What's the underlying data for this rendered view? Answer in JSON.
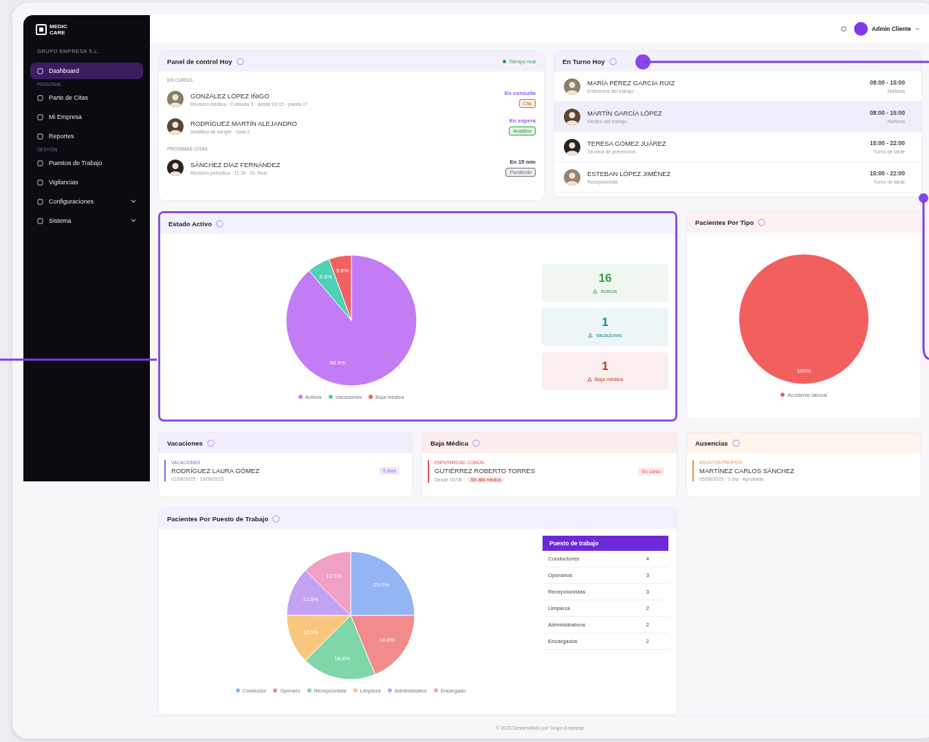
{
  "sidebar": {
    "logo": "MEDIC CARE",
    "company": "GRUPO EMPRESA S.L.",
    "sections": [
      {
        "items": [
          {
            "label": "Dashboard",
            "kind": "link",
            "selected": true
          }
        ]
      },
      {
        "heading": "PERSONAL",
        "items": [
          {
            "label": "Parte de Citas",
            "kind": "link",
            "selected": false
          },
          {
            "label": "Mi Empresa",
            "kind": "link",
            "selected": false
          },
          {
            "label": "Reportes",
            "kind": "link",
            "selected": false
          }
        ]
      },
      {
        "heading": "GESTIÓN",
        "items": [
          {
            "label": "Puestos de Trabajo",
            "kind": "link",
            "selected": false
          },
          {
            "label": "Vigilancias",
            "kind": "link",
            "selected": false
          },
          {
            "label": "Configuraciones",
            "kind": "menu",
            "selected": false
          },
          {
            "label": "Sistema",
            "kind": "menu",
            "selected": false
          }
        ]
      }
    ]
  },
  "header": {
    "user_name": "Admin Cliente"
  },
  "today_panel": {
    "title": "Panel de control Hoy",
    "status": "Tiempo real",
    "groups": [
      {
        "heading": "EN CURSO",
        "rows": [
          {
            "name": "GONZÁLEZ LÓPEZ ÍÑIGO",
            "detail": "Revisión médica · Consulta 3 · desde 09:15 · planta 1ª",
            "state": "En consulta",
            "kind": "current",
            "badge": {
              "text": "Cita",
              "color": "#b7791f"
            }
          },
          {
            "name": "RODRÍGUEZ MARTÍN ALEJANDRO",
            "detail": "Analítica de sangre · Sala 2",
            "state": "En espera",
            "kind": "current",
            "badge": {
              "text": "Analítica",
              "color": "#2f9e44"
            }
          }
        ]
      },
      {
        "heading": "PRÓXIMAS CITAS",
        "rows": [
          {
            "name": "SÁNCHEZ DÍAZ FERNÁNDEZ",
            "detail": "Revisión periódica · 11:30 · Dr. Ruiz",
            "state": "En 15 min",
            "kind": "upcoming",
            "badge": {
              "text": "Pendiente",
              "color": "#6b7280"
            }
          }
        ]
      }
    ]
  },
  "shift_panel": {
    "title": "En Turno Hoy",
    "rows": [
      {
        "name": "MARÍA PÉREZ GARCÍA RUIZ",
        "role": "Enfermera del trabajo",
        "time": "08:00 - 15:00",
        "shift": "Mañana",
        "selected": false
      },
      {
        "name": "MARTÍN GARCÍA LÓPEZ",
        "role": "Médico del trabajo",
        "time": "08:00 - 15:00",
        "shift": "Mañana",
        "selected": true
      },
      {
        "name": "TERESA GÓMEZ JUÁREZ",
        "role": "Técnica de prevención",
        "time": "15:00 - 22:00",
        "shift": "Turno de tarde",
        "selected": false
      },
      {
        "name": "ESTEBAN LÓPEZ JIMÉNEZ",
        "role": "Recepcionista",
        "time": "15:00 - 22:00",
        "shift": "Turno de tarde",
        "selected": false
      }
    ]
  },
  "status_card": {
    "title": "Estado Activo",
    "highlighted": true,
    "chart_data": {
      "type": "pie",
      "categories": [
        "Activos",
        "Vacaciones",
        "Baja médica"
      ],
      "colors": [
        "#c27cf5",
        "#4fd1b5",
        "#f06262"
      ],
      "series": [
        {
          "values": [
            88.9,
            5.6,
            5.6
          ]
        }
      ],
      "legend": "bottom",
      "value_labels": [
        "88.9%",
        "5.6%",
        "5.6%"
      ]
    },
    "stats": [
      {
        "value": "16",
        "label": "Activos",
        "color": "#2f9e44"
      },
      {
        "value": "1",
        "label": "Vacaciones",
        "color": "#0f8b8d"
      },
      {
        "value": "1",
        "label": "Baja médica",
        "color": "#c0392b"
      }
    ]
  },
  "type_card": {
    "title": "Pacientes Por Tipo",
    "chart_data": {
      "type": "pie",
      "categories": [
        "Accidente laboral"
      ],
      "colors": [
        "#f25f5f"
      ],
      "series": [
        {
          "values": [
            100
          ]
        }
      ],
      "legend": "bottom",
      "value_labels": [
        "100%"
      ]
    }
  },
  "absence_cards": [
    {
      "title": "Vacaciones",
      "color": "#8b5cf6",
      "tag": "VACACIONES",
      "name": "RODRÍGUEZ LAURA GÓMEZ",
      "detail": "01/08/2025 · 15/08/2025",
      "badge": "5 días"
    },
    {
      "title": "Baja Médica",
      "color": "#e05252",
      "tag": "ENFERMEDAD COMÚN",
      "name": "GUTIÉRREZ ROBERTO TORRES",
      "detail": "Desde 02/08 ·",
      "note": "Sin alta médica",
      "badge": "En curso"
    },
    {
      "title": "Ausencias",
      "color": "#e8963a",
      "tag": "ASUNTOS PROPIOS",
      "name": "MARTÍNEZ CARLOS SÁNCHEZ",
      "detail": "05/08/2025 · 1 día · Aprobada"
    }
  ],
  "job_card": {
    "title": "Pacientes Por Puesto de Trabajo",
    "chart_data": {
      "type": "pie",
      "categories": [
        "Conductor",
        "Operario",
        "Recepcionista",
        "Limpieza",
        "Administrativo",
        "Encargado"
      ],
      "colors": [
        "#93b5f5",
        "#f28b8b",
        "#7fd6a8",
        "#f6c77d",
        "#c4a2f2",
        "#f0a0c4"
      ],
      "series": [
        {
          "values": [
            25.0,
            18.8,
            18.8,
            12.5,
            12.5,
            12.5
          ]
        }
      ],
      "legend": "bottom",
      "value_labels": [
        "25.0%",
        "18.8%",
        "18.8%",
        "12.5%",
        "12.5%",
        "12.5%"
      ]
    },
    "table": {
      "heading": "Puesto de trabajo",
      "rows": [
        {
          "label": "Conductores",
          "value": "4"
        },
        {
          "label": "Operarios",
          "value": "3"
        },
        {
          "label": "Recepcionistas",
          "value": "3"
        },
        {
          "label": "Limpieza",
          "value": "2"
        },
        {
          "label": "Administrativos",
          "value": "2"
        },
        {
          "label": "Encargados",
          "value": "2"
        }
      ]
    }
  },
  "footer": "© 2025 Desarrollado por Grupo Empresa"
}
